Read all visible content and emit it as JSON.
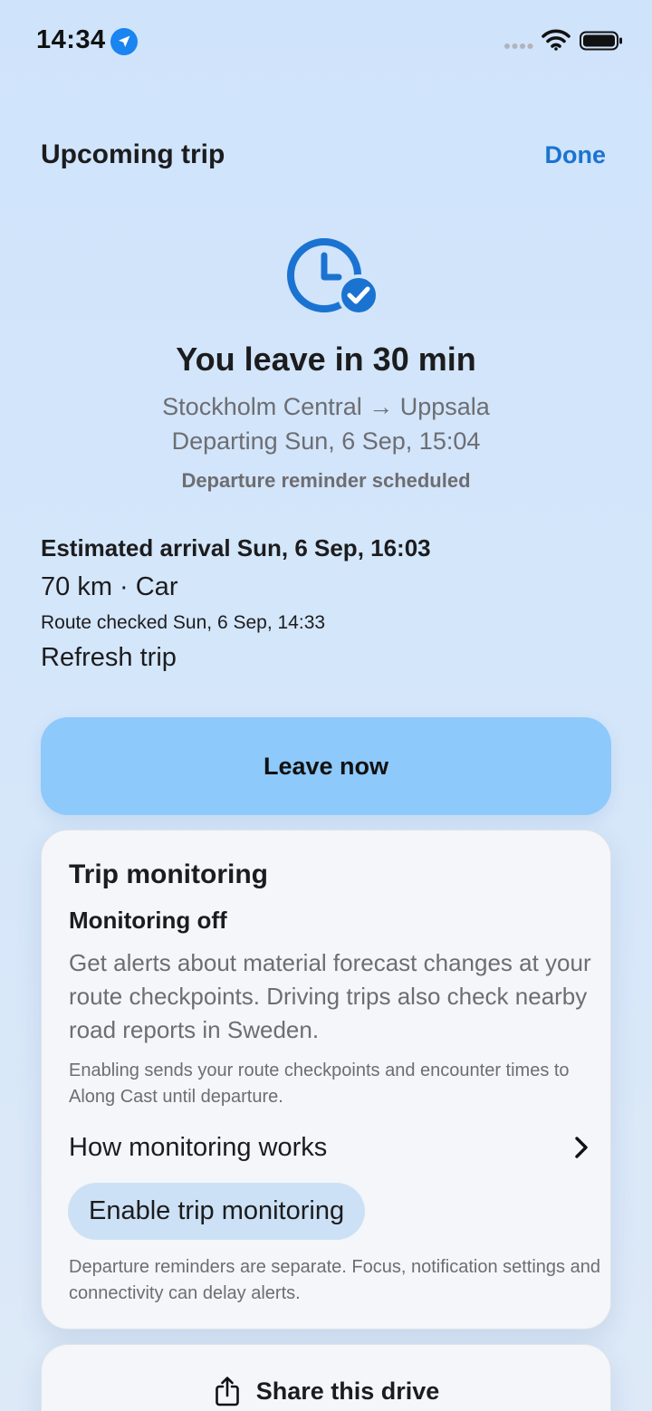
{
  "status_bar": {
    "time": "14:34"
  },
  "header": {
    "title": "Upcoming trip",
    "done_label": "Done"
  },
  "hero": {
    "icon": "clock-check-icon",
    "title": "You leave in 30 min",
    "route": "Stockholm Central → Uppsala",
    "departing": "Departing Sun, 6 Sep, 15:04",
    "reminder": "Departure reminder scheduled"
  },
  "trip": {
    "arrival": "Estimated arrival Sun, 6 Sep, 16:03",
    "distance_mode": "70 km · Car",
    "route_checked": "Route checked Sun, 6 Sep, 14:33",
    "refresh_label": "Refresh trip"
  },
  "leave_button": {
    "label": "Leave now"
  },
  "monitoring": {
    "title": "Trip monitoring",
    "status": "Monitoring off",
    "description": "Get alerts about material forecast changes at your route checkpoints. Driving trips also check nearby road reports in Sweden.",
    "note": "Enabling sends your route checkpoints and encounter times to Along Cast until departure.",
    "how_label": "How monitoring works",
    "enable_label": "Enable trip monitoring",
    "footer": "Departure reminders are separate. Focus, notification settings and connectivity can delay alerts."
  },
  "share": {
    "label": "Share this drive",
    "icon": "share-icon"
  },
  "colors": {
    "accent": "#1a73d1",
    "leave_button": "#8ec9fb",
    "enable_button": "#cce1f5",
    "secondary_text": "#6d6d72"
  }
}
